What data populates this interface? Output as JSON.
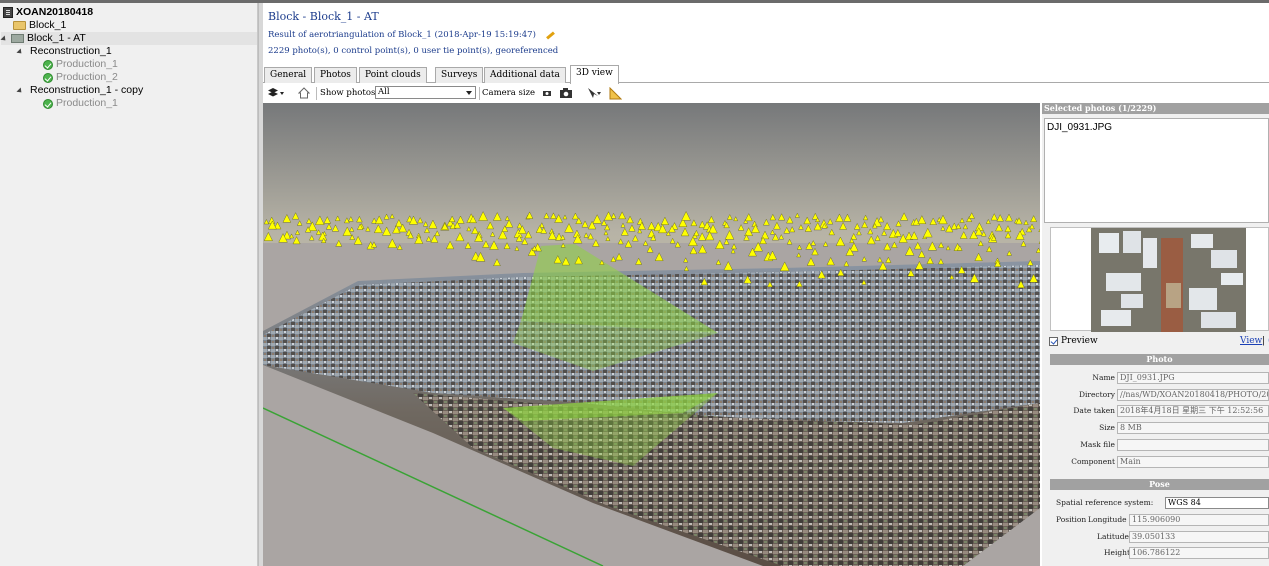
{
  "tree": {
    "project": "XOAN20180418",
    "items": [
      {
        "label": "Block_1"
      },
      {
        "label": "Block_1 - AT"
      },
      {
        "label": "Reconstruction_1"
      },
      {
        "label": "Production_1"
      },
      {
        "label": "Production_2"
      },
      {
        "label": "Reconstruction_1 - copy"
      },
      {
        "label": "Production_1"
      }
    ]
  },
  "header": {
    "title": "Block - Block_1 - AT",
    "result": "Result of aerotriangulation of Block_1 (2018-Apr-19 15:19:47)",
    "stats": "2229 photo(s), 0 control point(s), 0 user tie point(s), georeferenced"
  },
  "tabs": [
    "General",
    "Photos",
    "Point clouds",
    "Surveys",
    "Additional data",
    "3D view"
  ],
  "active_tab": "3D view",
  "toolbar": {
    "show_photos_label": "Show photos",
    "show_photos_value": "All",
    "camera_size_label": "Camera size"
  },
  "selected": {
    "header": "Selected photos (1/2229)",
    "items": [
      "DJI_0931.JPG"
    ],
    "preview_label": "Preview",
    "view_link": "View",
    "link_sep": "|",
    "link_more": "("
  },
  "photo": {
    "header": "Photo",
    "fields": [
      {
        "label": "Name",
        "value": "DJI_0931.JPG"
      },
      {
        "label": "Directory",
        "value": "//nas/WD/XOAN20180418/PHOTO/20180"
      },
      {
        "label": "Date taken",
        "value": "2018年4月18日 星期三 下午 12:52:56"
      },
      {
        "label": "Size",
        "value": "8 MB"
      },
      {
        "label": "Mask file",
        "value": ""
      },
      {
        "label": "Component",
        "value": "Main"
      }
    ]
  },
  "pose": {
    "header": "Pose",
    "srs_label": "Spatial reference system:",
    "srs_value": "WGS 84",
    "position_label": "Position",
    "longitude_label": "Longitude",
    "longitude_value": "115.906090",
    "latitude_label": "Latitude",
    "latitude_value": "39.050133",
    "height_label": "Height",
    "height_value": "106.786122"
  },
  "colors": {
    "title_blue": "#1c3c8c",
    "link_blue": "#1a3fb5",
    "camera_yellow": "#ffff00",
    "frustum_green": "#8ed640",
    "panel_header": "#a1a1a1"
  }
}
